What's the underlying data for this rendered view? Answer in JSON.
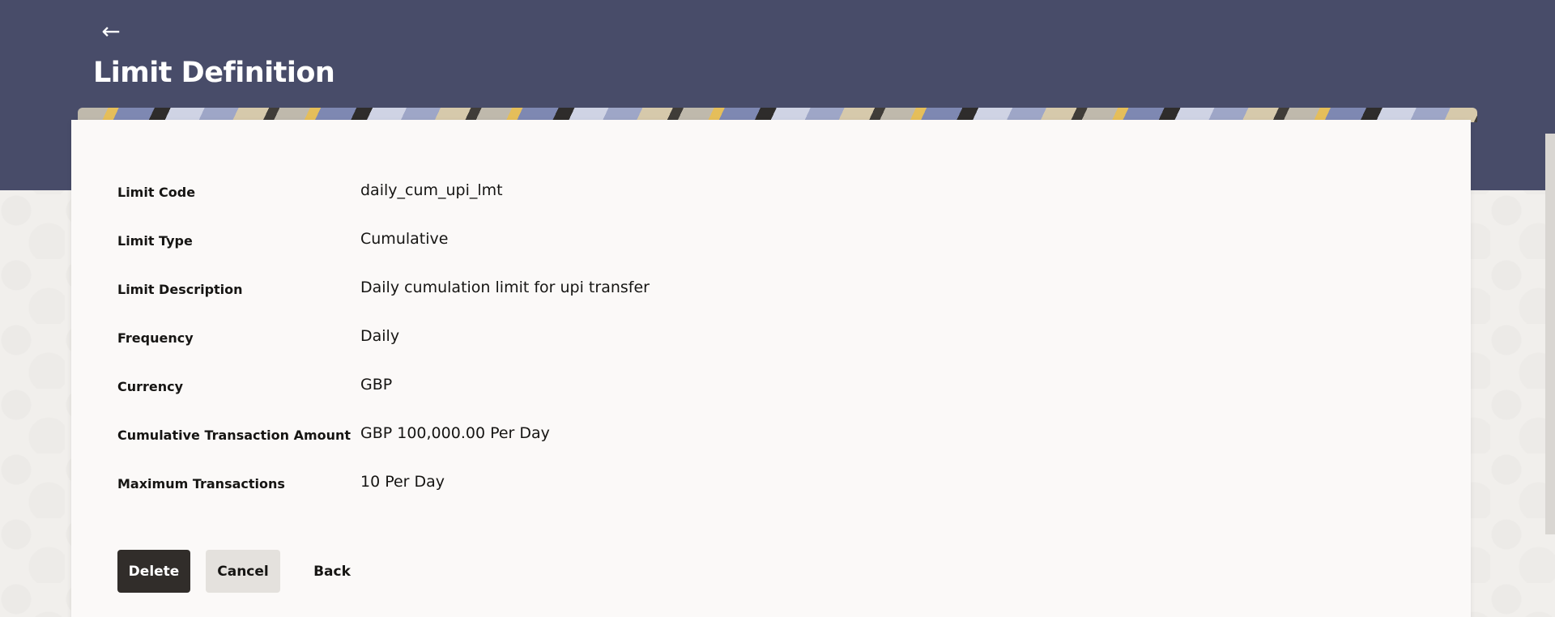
{
  "header": {
    "back_icon": "arrow-left-icon",
    "back_glyph": "←",
    "title": "Limit Definition"
  },
  "details": [
    {
      "label": "Limit Code",
      "value": "daily_cum_upi_lmt"
    },
    {
      "label": "Limit Type",
      "value": "Cumulative"
    },
    {
      "label": "Limit Description",
      "value": "Daily cumulation limit for upi transfer"
    },
    {
      "label": "Frequency",
      "value": "Daily"
    },
    {
      "label": "Currency",
      "value": "GBP"
    },
    {
      "label": "Cumulative Transaction Amount",
      "value": "GBP 100,000.00 Per Day"
    },
    {
      "label": "Maximum Transactions",
      "value": "10 Per Day"
    }
  ],
  "actions": {
    "delete_label": "Delete",
    "cancel_label": "Cancel",
    "back_label": "Back"
  },
  "colors": {
    "header_bg": "#484c69",
    "primary_button": "#312d2a",
    "secondary_button": "#e4e1dd"
  }
}
